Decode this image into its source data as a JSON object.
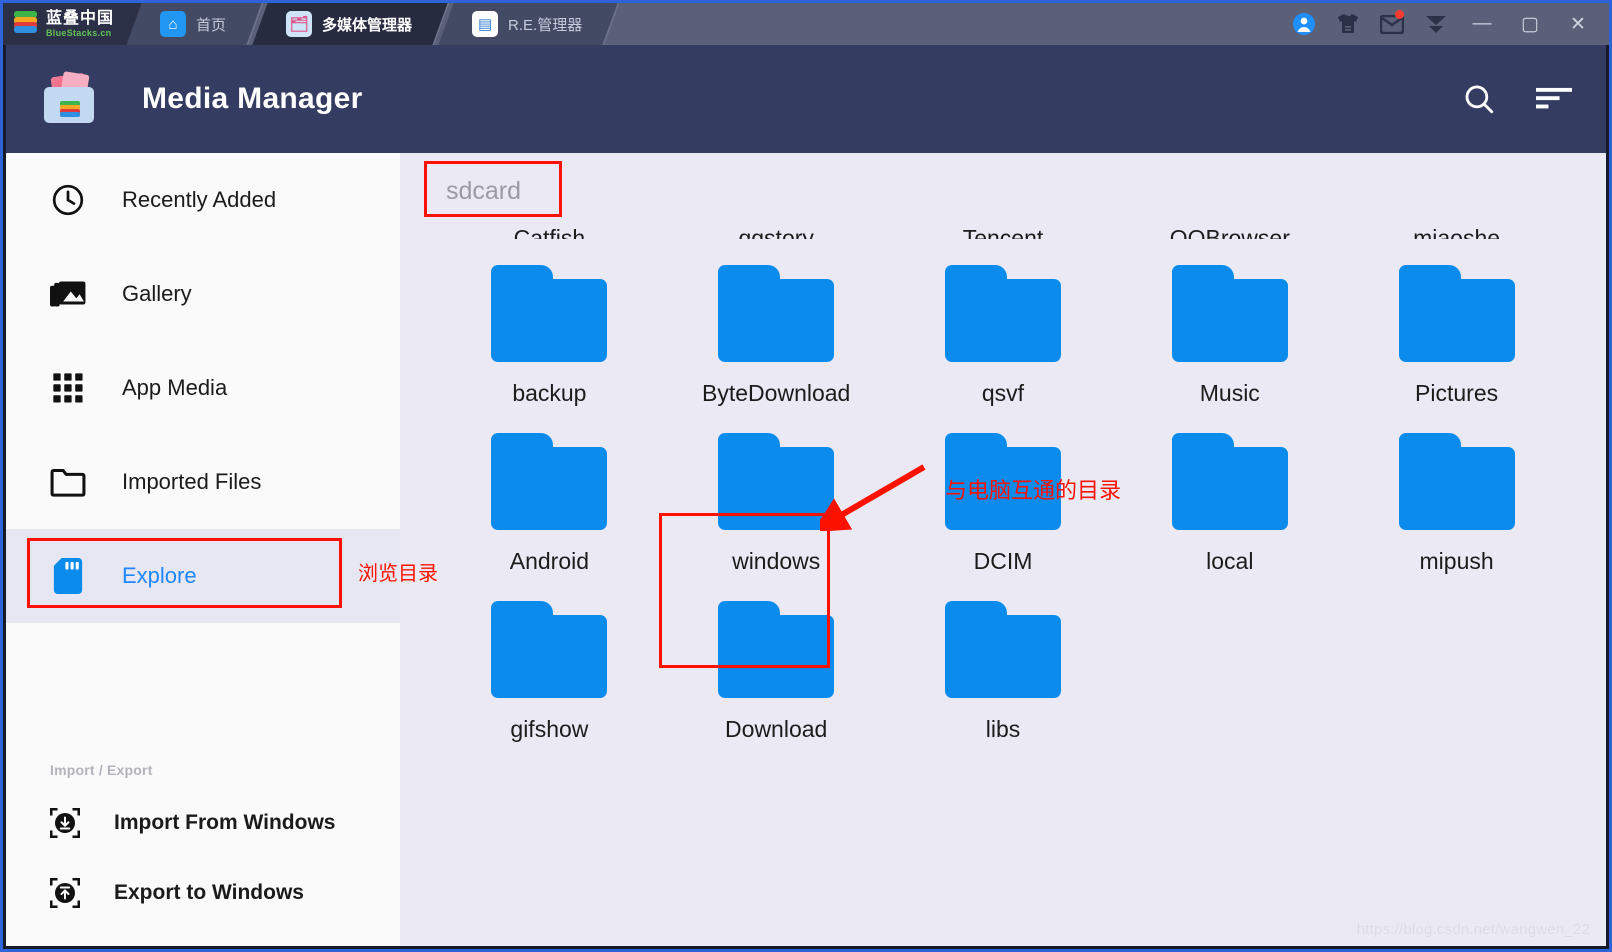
{
  "window": {
    "brand": {
      "cn": "蓝叠中国",
      "en": "BlueStacks.cn"
    },
    "tabs": [
      {
        "label": "首页",
        "icon": "home-icon",
        "active": false
      },
      {
        "label": "多媒体管理器",
        "icon": "media-manager-icon",
        "active": true
      },
      {
        "label": "R.E.管理器",
        "icon": "re-manager-icon",
        "active": false
      }
    ],
    "tray": [
      {
        "name": "account-avatar-icon"
      },
      {
        "name": "tshirt-skin-icon"
      },
      {
        "name": "mail-icon",
        "badge": true
      },
      {
        "name": "collapse-arrow-icon"
      }
    ],
    "controls": {
      "minimize": "—",
      "maximize": "▢",
      "close": "✕"
    }
  },
  "appbar": {
    "title": "Media Manager",
    "logo": "media-manager-app-icon",
    "actions": [
      {
        "name": "search-icon"
      },
      {
        "name": "sort-filter-icon"
      }
    ]
  },
  "sidebar": {
    "items": [
      {
        "label": "Recently Added",
        "icon": "clock-icon",
        "selected": false
      },
      {
        "label": "Gallery",
        "icon": "photo-library-icon",
        "selected": false
      },
      {
        "label": "App Media",
        "icon": "grid-apps-icon",
        "selected": false
      },
      {
        "label": "Imported Files",
        "icon": "folder-icon",
        "selected": false
      },
      {
        "label": "Explore",
        "icon": "sdcard-icon",
        "selected": true
      }
    ],
    "section_label": "Import / Export",
    "transfer_items": [
      {
        "label": "Import From Windows",
        "icon": "download-into-box-icon"
      },
      {
        "label": "Export to Windows",
        "icon": "upload-from-box-icon"
      }
    ]
  },
  "content": {
    "breadcrumb": "sdcard",
    "rows": [
      [
        {
          "name": "Catfish",
          "clipped": true
        },
        {
          "name": "qqstory",
          "clipped": true
        },
        {
          "name": "Tencent",
          "clipped": true
        },
        {
          "name": "QQBrowser",
          "clipped": true
        },
        {
          "name": "miaoshe",
          "clipped": true
        }
      ],
      [
        {
          "name": "backup"
        },
        {
          "name": "ByteDownload"
        },
        {
          "name": "qsvf"
        },
        {
          "name": "Music"
        },
        {
          "name": "Pictures"
        }
      ],
      [
        {
          "name": "Android"
        },
        {
          "name": "windows",
          "highlighted": true
        },
        {
          "name": "DCIM"
        },
        {
          "name": "local"
        },
        {
          "name": "mipush"
        }
      ],
      [
        {
          "name": "gifshow"
        },
        {
          "name": "Download"
        },
        {
          "name": "libs"
        }
      ]
    ],
    "watermark": "https://blog.csdn.net/wangwen_22"
  },
  "annotations": {
    "breadcrumb_note": "sdcard",
    "explore_note": "浏览目录",
    "windows_note": "与电脑互通的目录",
    "color": "#fd1100"
  }
}
